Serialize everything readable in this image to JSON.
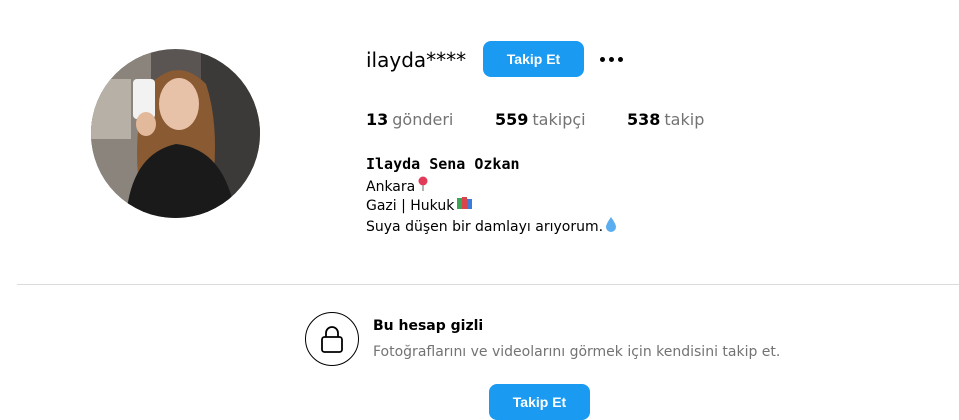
{
  "profile": {
    "username": "ilayda****",
    "follow_label": "Takip Et",
    "more_icon": "more-horizontal-icon",
    "stats": [
      {
        "count": "13",
        "label": "gönderi"
      },
      {
        "count": "559",
        "label": "takipçi"
      },
      {
        "count": "538",
        "label": "takip"
      }
    ],
    "full_name": "Ilayda Sena Ozkan",
    "bio": [
      {
        "text": "Ankara",
        "emoji": "pin-icon"
      },
      {
        "text": "Gazi | Hukuk",
        "emoji": "books-icon"
      },
      {
        "text": "Suya düşen bir damlayı arıyorum.",
        "emoji": "droplet-icon"
      }
    ]
  },
  "private_notice": {
    "icon": "lock-icon",
    "title": "Bu hesap gizli",
    "description": "Fotoğraflarını ve videolarını görmek için kendisini takip et.",
    "follow_label": "Takip Et"
  },
  "colors": {
    "accent": "#1a9af0",
    "muted_text": "#737373",
    "divider": "#dbdbdb"
  }
}
